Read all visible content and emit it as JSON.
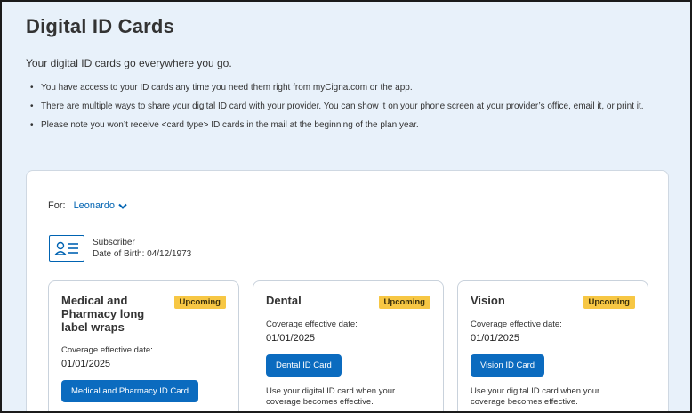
{
  "header": {
    "title": "Digital ID Cards",
    "subtitle": "Your digital ID cards go everywhere you go."
  },
  "bullets": [
    "You have access to your ID cards any time you need them right from myCigna.com or the app.",
    "There are multiple ways to share your digital ID card with your provider. You can show it on your phone screen at your provider’s office, email it, or print it.",
    "Please note you won’t receive <card type> ID cards in the mail at the beginning of the plan year."
  ],
  "member": {
    "for_label": "For:",
    "name": "Leonardo"
  },
  "subscriber": {
    "role": "Subscriber",
    "dob": "Date of Birth: 04/12/1973"
  },
  "cards": [
    {
      "title": "Medical and Pharmacy long label wraps",
      "badge": "Upcoming",
      "coverage_label": "Coverage effective date:",
      "coverage_date": "01/01/2025",
      "button": "Medical and Pharmacy ID Card",
      "note": ""
    },
    {
      "title": "Dental",
      "badge": "Upcoming",
      "coverage_label": "Coverage effective date:",
      "coverage_date": "01/01/2025",
      "button": "Dental ID Card",
      "note": "Use your digital ID card when your coverage becomes effective."
    },
    {
      "title": "Vision",
      "badge": "Upcoming",
      "coverage_label": "Coverage effective date:",
      "coverage_date": "01/01/2025",
      "button": "Vision ID Card",
      "note": "Use your digital ID card when your coverage becomes effective."
    }
  ],
  "icons": {
    "dropdown": "chevron-down-icon",
    "id_card": "id-card-icon"
  },
  "colors": {
    "background": "#e8f1fa",
    "accent": "#0b6bbf",
    "link": "#0063b2",
    "badge": "#f7c744"
  }
}
